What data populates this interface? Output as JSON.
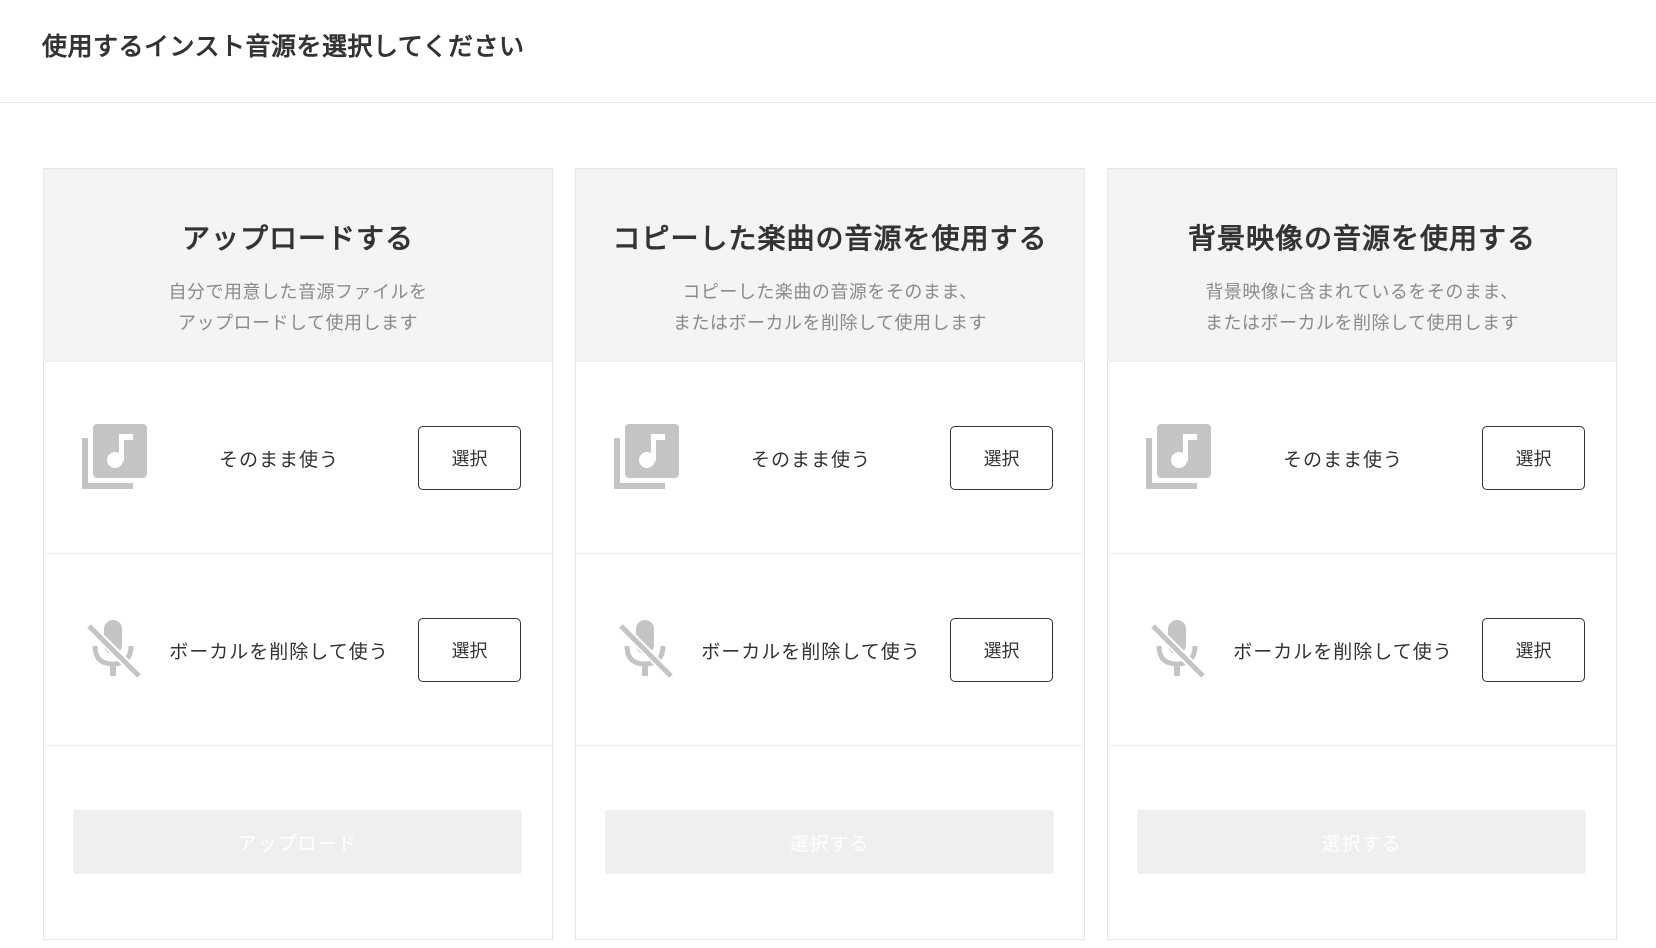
{
  "page": {
    "title": "使用するインスト音源を選択してください"
  },
  "colors": {
    "accent_text": "#333333",
    "muted_text": "#8a8a8a",
    "card_header_bg": "#f4f4f4",
    "disabled_button_bg": "#efefef",
    "icon_gray": "#c4c4c4"
  },
  "cards": [
    {
      "title": "アップロードする",
      "desc_line1": "自分で用意した音源ファイルを",
      "desc_line2": "アップロードして使用します",
      "options": [
        {
          "icon": "music-library-icon",
          "label": "そのまま使う",
          "button": "選択"
        },
        {
          "icon": "mic-off-icon",
          "label": "ボーカルを削除して使う",
          "button": "選択"
        }
      ],
      "action": {
        "label": "アップロード",
        "disabled": true
      }
    },
    {
      "title": "コピーした楽曲の音源を使用する",
      "desc_line1": "コピーした楽曲の音源をそのまま、",
      "desc_line2": "またはボーカルを削除して使用します",
      "options": [
        {
          "icon": "music-library-icon",
          "label": "そのまま使う",
          "button": "選択"
        },
        {
          "icon": "mic-off-icon",
          "label": "ボーカルを削除して使う",
          "button": "選択"
        }
      ],
      "action": {
        "label": "選択する",
        "disabled": true
      }
    },
    {
      "title": "背景映像の音源を使用する",
      "desc_line1": "背景映像に含まれているをそのまま、",
      "desc_line2": "またはボーカルを削除して使用します",
      "options": [
        {
          "icon": "music-library-icon",
          "label": "そのまま使う",
          "button": "選択"
        },
        {
          "icon": "mic-off-icon",
          "label": "ボーカルを削除して使う",
          "button": "選択"
        }
      ],
      "action": {
        "label": "選択する",
        "disabled": true
      }
    }
  ]
}
